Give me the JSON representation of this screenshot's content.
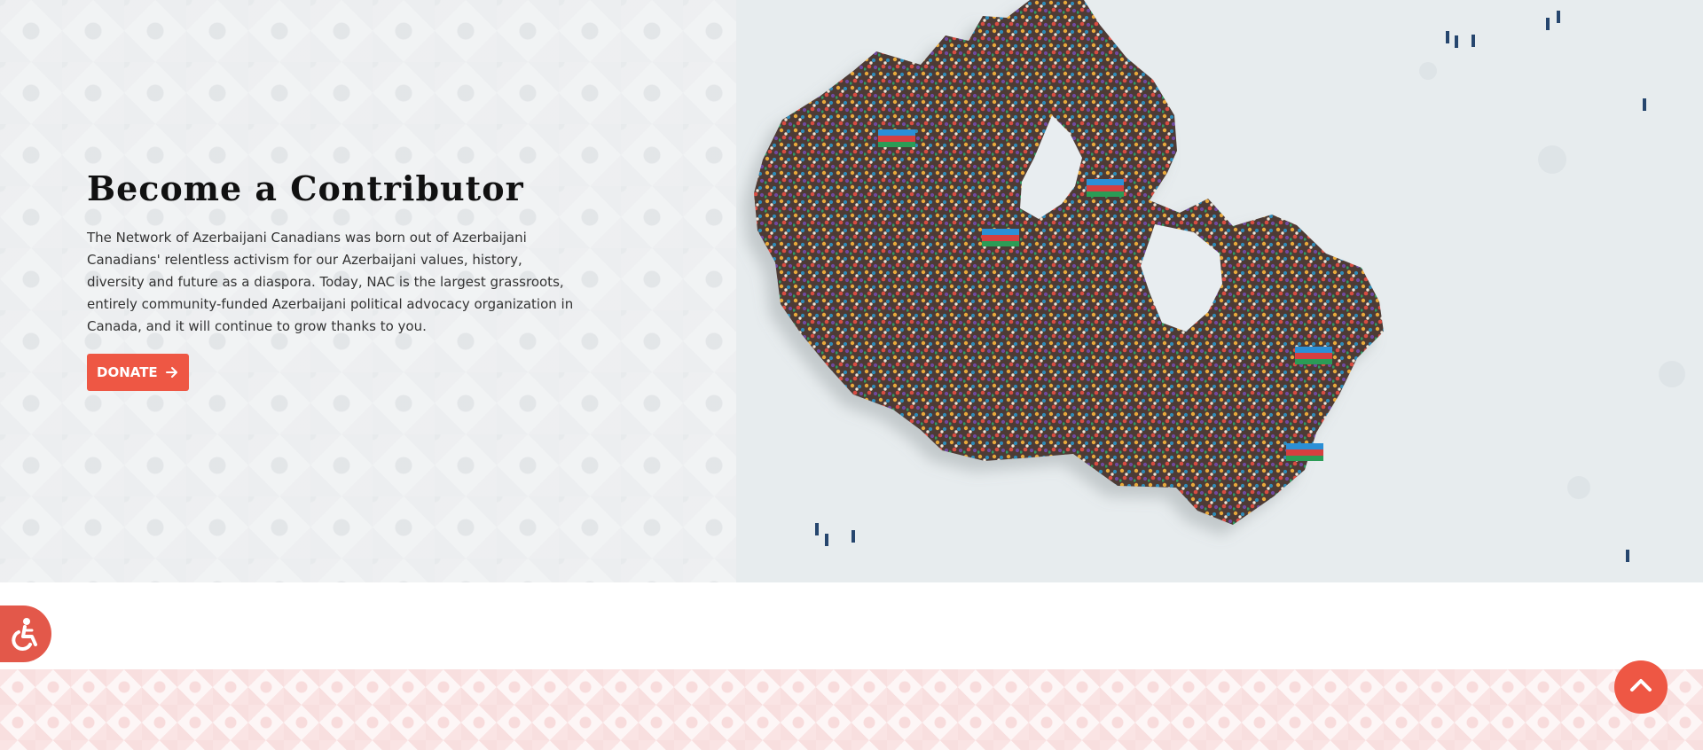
{
  "hero": {
    "title": "Become a Contributor",
    "description": "The Network of Azerbaijani Canadians was born out of Azerbaijani Canadians' relentless activism for our Azerbaijani values, history, diversity and future as a diaspora. Today, NAC is the largest grassroots, entirely community-funded Azerbaijani political advocacy organization in Canada, and it will continue to grow thanks to you.",
    "donate_label": "DONATE",
    "donate_icon": "arrow-right-icon",
    "image": "crowd-shaped-as-canada-map-with-azerbaijani-flags"
  },
  "floating": {
    "accessibility_icon": "accessibility-wheelchair-icon",
    "scroll_top_icon": "chevron-up-icon"
  },
  "colors": {
    "accent": "#EE5744",
    "title": "#111111",
    "body_text": "#333333",
    "hero_background": "#F1F3F4",
    "footer_pattern": "#F7D6D6"
  }
}
